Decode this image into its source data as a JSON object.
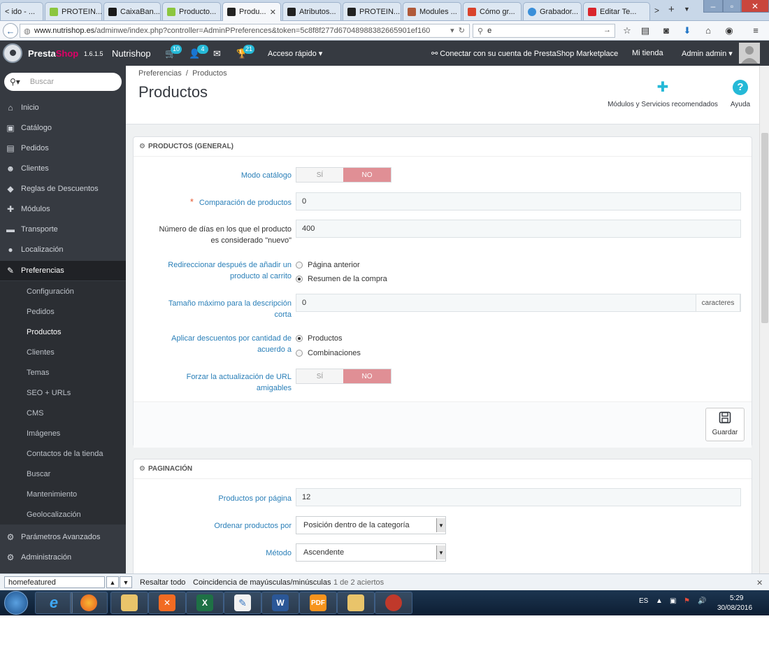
{
  "browser": {
    "tabs": [
      {
        "label": "ido - ...",
        "color": "#e07a3a",
        "active": false
      },
      {
        "label": "PROTEIN...",
        "color": "#8cc63f",
        "active": false
      },
      {
        "label": "CaixaBan...",
        "color": "#1a1a1a",
        "active": false
      },
      {
        "label": "Producto...",
        "color": "#8cc63f",
        "active": false
      },
      {
        "label": "Produ...",
        "color": "#222222",
        "active": true
      },
      {
        "label": "Atributos...",
        "color": "#222222",
        "active": false
      },
      {
        "label": "PROTEIN...",
        "color": "#222222",
        "active": false
      },
      {
        "label": "Modules ...",
        "color": "#b05a3a",
        "active": false
      },
      {
        "label": "Cómo gr...",
        "color": "#d9432c",
        "active": false
      },
      {
        "label": "Grabador...",
        "color": "#3a8fd9",
        "active": false
      },
      {
        "label": "Editar Te...",
        "color": "#d9252c",
        "active": false
      }
    ],
    "url_host": "www.nutrishop.es",
    "url_path": "/adminwe/index.php?controller=AdminPPreferences&token=5c8f8f277d67048988382665901ef160",
    "search_value": "e"
  },
  "header": {
    "logo_presta": "Presta",
    "logo_shop": "Shop",
    "version": "1.6.1.5",
    "shop_name": "Nutrishop",
    "badge_cart": "10",
    "badge_users": "4",
    "badge_trophy": "21",
    "quick_access": "Acceso rápido",
    "marketplace": "Conectar con su cuenta de PrestaShop Marketplace",
    "my_shop": "Mi tienda",
    "user": "Admin admin"
  },
  "sidebar": {
    "search_placeholder": "Buscar",
    "items": [
      {
        "label": "Inicio",
        "icon": "⌂"
      },
      {
        "label": "Catálogo",
        "icon": "▣"
      },
      {
        "label": "Pedidos",
        "icon": "▤"
      },
      {
        "label": "Clientes",
        "icon": "☻"
      },
      {
        "label": "Reglas de Descuentos",
        "icon": "◆"
      },
      {
        "label": "Módulos",
        "icon": "✚"
      },
      {
        "label": "Transporte",
        "icon": "▬"
      },
      {
        "label": "Localización",
        "icon": "●"
      },
      {
        "label": "Preferencias",
        "icon": "✎"
      }
    ],
    "sub_items": [
      "Configuración",
      "Pedidos",
      "Productos",
      "Clientes",
      "Temas",
      "SEO + URLs",
      "CMS",
      "Imágenes",
      "Contactos de la tienda",
      "Buscar",
      "Mantenimiento",
      "Geolocalización"
    ],
    "bottom_items": [
      {
        "label": "Parámetros Avanzados",
        "icon": "⚙"
      },
      {
        "label": "Administración",
        "icon": "⚙"
      }
    ]
  },
  "page": {
    "breadcrumb_1": "Preferencias",
    "breadcrumb_sep": "/",
    "breadcrumb_2": "Productos",
    "title": "Productos",
    "modules_label": "Módulos y Servicios recomendados",
    "help_label": "Ayuda"
  },
  "panel_general": {
    "heading": "PRODUCTOS (GENERAL)",
    "catalog_mode_label": "Modo catálogo",
    "yes": "SÍ",
    "no": "NO",
    "compare_label": "Comparación de productos",
    "compare_value": "0",
    "new_days_label_1": "Número de días en los que el producto",
    "new_days_label_2": "es considerado \"nuevo\"",
    "new_days_value": "400",
    "redirect_label_1": "Redireccionar después de añadir un",
    "redirect_label_2": "producto al carrito",
    "redirect_opt_1": "Página anterior",
    "redirect_opt_2": "Resumen de la compra",
    "maxdesc_label_1": "Tamaño máximo para la descripción",
    "maxdesc_label_2": "corta",
    "maxdesc_value": "0",
    "maxdesc_unit": "caracteres",
    "discount_label_1": "Aplicar descuentos por cantidad de",
    "discount_label_2": "acuerdo a",
    "discount_opt_1": "Productos",
    "discount_opt_2": "Combinaciones",
    "force_url_label_1": "Forzar la actualización de URL",
    "force_url_label_2": "amigables",
    "save_label": "Guardar"
  },
  "panel_pagination": {
    "heading": "PAGINACIÓN",
    "per_page_label": "Productos por página",
    "per_page_value": "12",
    "order_by_label": "Ordenar productos por",
    "order_by_value": "Posición dentro de la categoría",
    "method_label": "Método",
    "method_value": "Ascendente"
  },
  "findbar": {
    "query": "homefeatured",
    "highlight_all": "Resaltar todo",
    "match_case": "Coincidencia de mayúsculas/minúsculas",
    "result": "1 de 2 aciertos"
  },
  "taskbar": {
    "lang": "ES",
    "time": "5:29",
    "date": "30/08/2016"
  }
}
